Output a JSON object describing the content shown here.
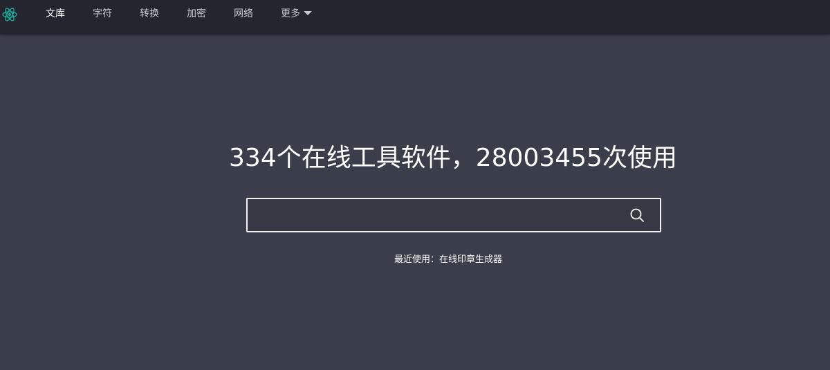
{
  "nav": {
    "logo_icon": "atom-icon",
    "items": [
      {
        "label": "文库",
        "active": true
      },
      {
        "label": "字符",
        "active": false
      },
      {
        "label": "转换",
        "active": false
      },
      {
        "label": "加密",
        "active": false
      },
      {
        "label": "网络",
        "active": false
      },
      {
        "label": "更多",
        "active": false,
        "dropdown": true
      }
    ]
  },
  "hero": {
    "title": "334个在线工具软件，28003455次使用"
  },
  "search": {
    "value": "",
    "placeholder": "",
    "icon": "search-icon"
  },
  "recent": {
    "label": "最近使用：",
    "link": "在线印章生成器"
  },
  "colors": {
    "background": "#3a3d4a",
    "navbar": "#24252f",
    "logo_accent": "#1aa89a"
  }
}
